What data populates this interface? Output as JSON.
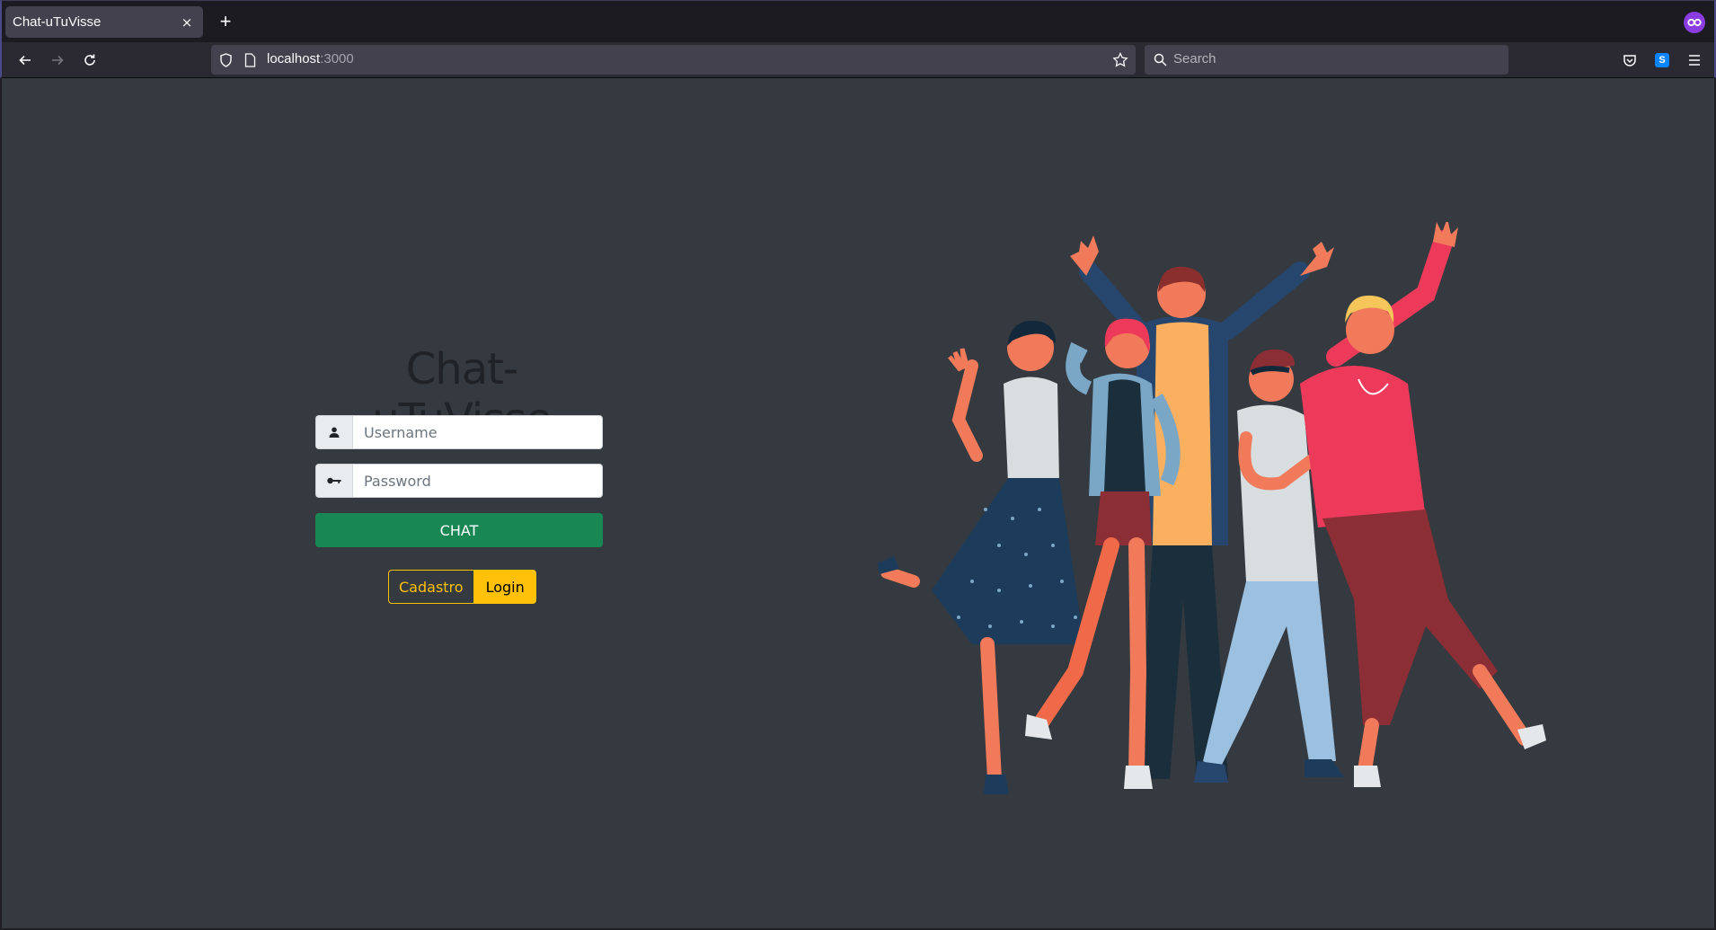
{
  "browser": {
    "tab_title": "Chat-uTuVisse",
    "tab_close": "×",
    "new_tab": "+",
    "url_host": "localhost",
    "url_port": ":3000",
    "search_placeholder": "Search"
  },
  "login": {
    "brand": "Chat-uTuVisse",
    "username_placeholder": "Username",
    "password_placeholder": "Password",
    "chat_label": "CHAT",
    "cadastro_label": "Cadastro",
    "login_label": "Login"
  },
  "colors": {
    "page_bg": "#343a40",
    "success": "#198754",
    "warning": "#ffc107"
  },
  "icons": {
    "username": "user-icon",
    "password": "key-icon",
    "illustration": "group-of-people-illustration"
  }
}
